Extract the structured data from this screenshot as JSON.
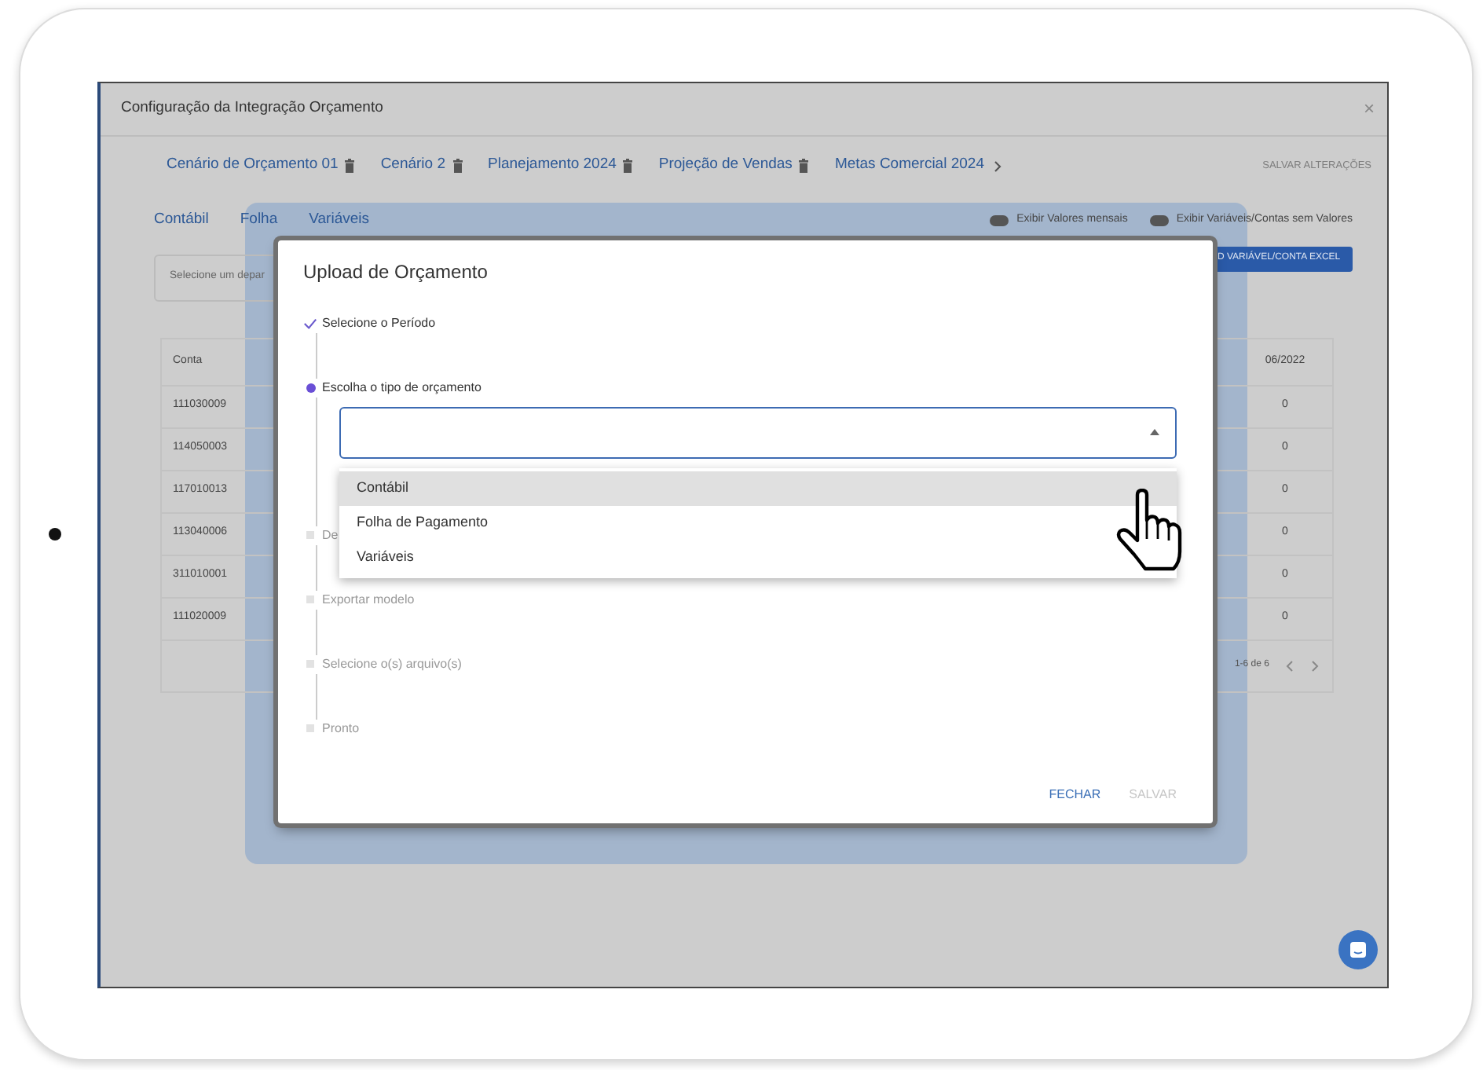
{
  "window": {
    "title": "Configuração da Integração Orçamento",
    "close": "×"
  },
  "scenario_tabs": [
    {
      "label": "Cenário de Orçamento 01"
    },
    {
      "label": "Cenário 2"
    },
    {
      "label": "Planejamento 2024"
    },
    {
      "label": "Projeção de Vendas"
    },
    {
      "label": "Metas Comercial 2024"
    }
  ],
  "save_changes": "SALVAR ALTERAÇÕES",
  "sub_tabs": [
    {
      "label": "Contábil"
    },
    {
      "label": "Folha"
    },
    {
      "label": "Variáveis"
    }
  ],
  "toggles": [
    {
      "label": "Exibir Valores mensais",
      "on": false
    },
    {
      "label": "Exibir Variáveis/Contas sem Valores",
      "on": false
    }
  ],
  "upload_button": "D VARIÁVEL/CONTA EXCEL",
  "department_select": {
    "placeholder": "Selecione um depar"
  },
  "table": {
    "columns": [
      "Conta",
      "06/2022"
    ],
    "rows": [
      [
        "111030009",
        "0"
      ],
      [
        "114050003",
        "0"
      ],
      [
        "117010013",
        "0"
      ],
      [
        "113040006",
        "0"
      ],
      [
        "311010001",
        "0"
      ],
      [
        "111020009",
        "0"
      ]
    ],
    "pagination": "1-6 de 6"
  },
  "dialog": {
    "title": "Upload de Orçamento",
    "steps": [
      {
        "label": "Selecione o Período",
        "completed": true,
        "current": false
      },
      {
        "label": "Escolha o tipo de orçamento",
        "completed": false,
        "current": true
      },
      {
        "label": "De",
        "completed": false,
        "current": false
      },
      {
        "label": "Exportar modelo",
        "completed": false,
        "current": false
      },
      {
        "label": "Selecione o(s) arquivo(s)",
        "completed": false,
        "current": false
      },
      {
        "label": "Pronto",
        "completed": false,
        "current": false
      }
    ],
    "type_select": {
      "expanded": true,
      "options": [
        {
          "label": "Contábil",
          "selected": true
        },
        {
          "label": "Folha de Pagamento",
          "selected": false
        },
        {
          "label": "Variáveis",
          "selected": false
        }
      ]
    },
    "buttons": [
      {
        "label": "FECHAR",
        "disabled": false
      },
      {
        "label": "SALVAR",
        "disabled": true
      }
    ]
  }
}
